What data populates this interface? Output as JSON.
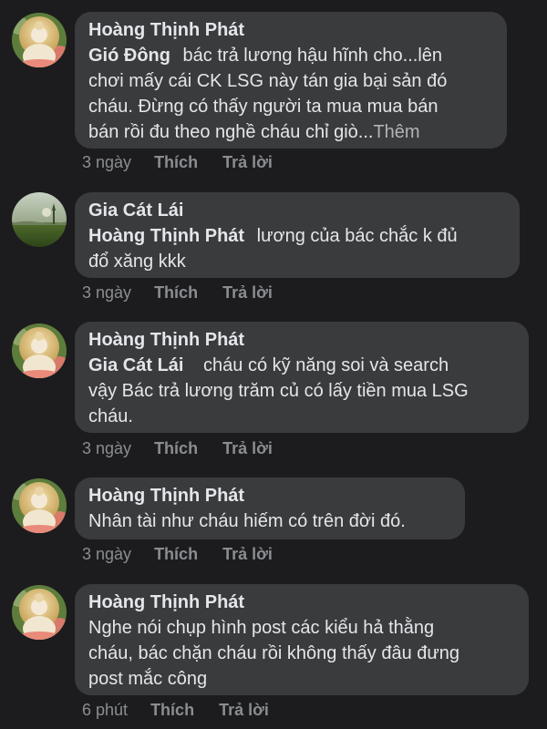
{
  "comments": [
    {
      "author": "Hoàng Thịnh Phát",
      "mention": "Gió Đông",
      "lines": [
        "bác trả lương hậu hĩnh cho...lên",
        "chơi mấy cái CK LSG này tán gia bại sản đó",
        "cháu. Đừng có thấy người ta mua mua bán",
        "bán rồi đu theo nghề cháu chỉ giò..."
      ],
      "more": "Thêm",
      "time": "3 ngày",
      "like": "Thích",
      "reply": "Trả lời",
      "avatar": "buddha-avatar"
    },
    {
      "author": "Gia Cát Lái",
      "mention": "Hoàng Thịnh Phát",
      "lines": [
        "lương của bác chắc k đủ",
        "đổ xăng kkk"
      ],
      "time": "3 ngày",
      "like": "Thích",
      "reply": "Trả lời",
      "avatar": "landscape-avatar"
    },
    {
      "author": "Hoàng Thịnh Phát",
      "mention": "Gia Cát Lái",
      "lines": [
        "cháu có kỹ năng soi và search",
        "vậy Bác trả lương trăm củ có lấy tiền mua LSG",
        "cháu."
      ],
      "time": "3 ngày",
      "like": "Thích",
      "reply": "Trả lời",
      "avatar": "buddha-avatar"
    },
    {
      "author": "Hoàng Thịnh Phát",
      "lines": [
        "Nhân tài như cháu hiếm có trên đời đó."
      ],
      "time": "3 ngày",
      "like": "Thích",
      "reply": "Trả lời",
      "avatar": "buddha-avatar"
    },
    {
      "author": "Hoàng Thịnh Phát",
      "lines": [
        "Nghe nói chụp hình post các kiểu hả thằng",
        "cháu, bác chặn cháu rồi không thấy đâu đưng",
        "post mắc công"
      ],
      "time": "6 phút",
      "like": "Thích",
      "reply": "Trả lời",
      "avatar": "buddha-avatar"
    }
  ],
  "colors": {
    "background": "#1c1c1e",
    "bubble": "#3a3b3c",
    "text": "#e4e6eb",
    "meta": "#8a8d91"
  }
}
